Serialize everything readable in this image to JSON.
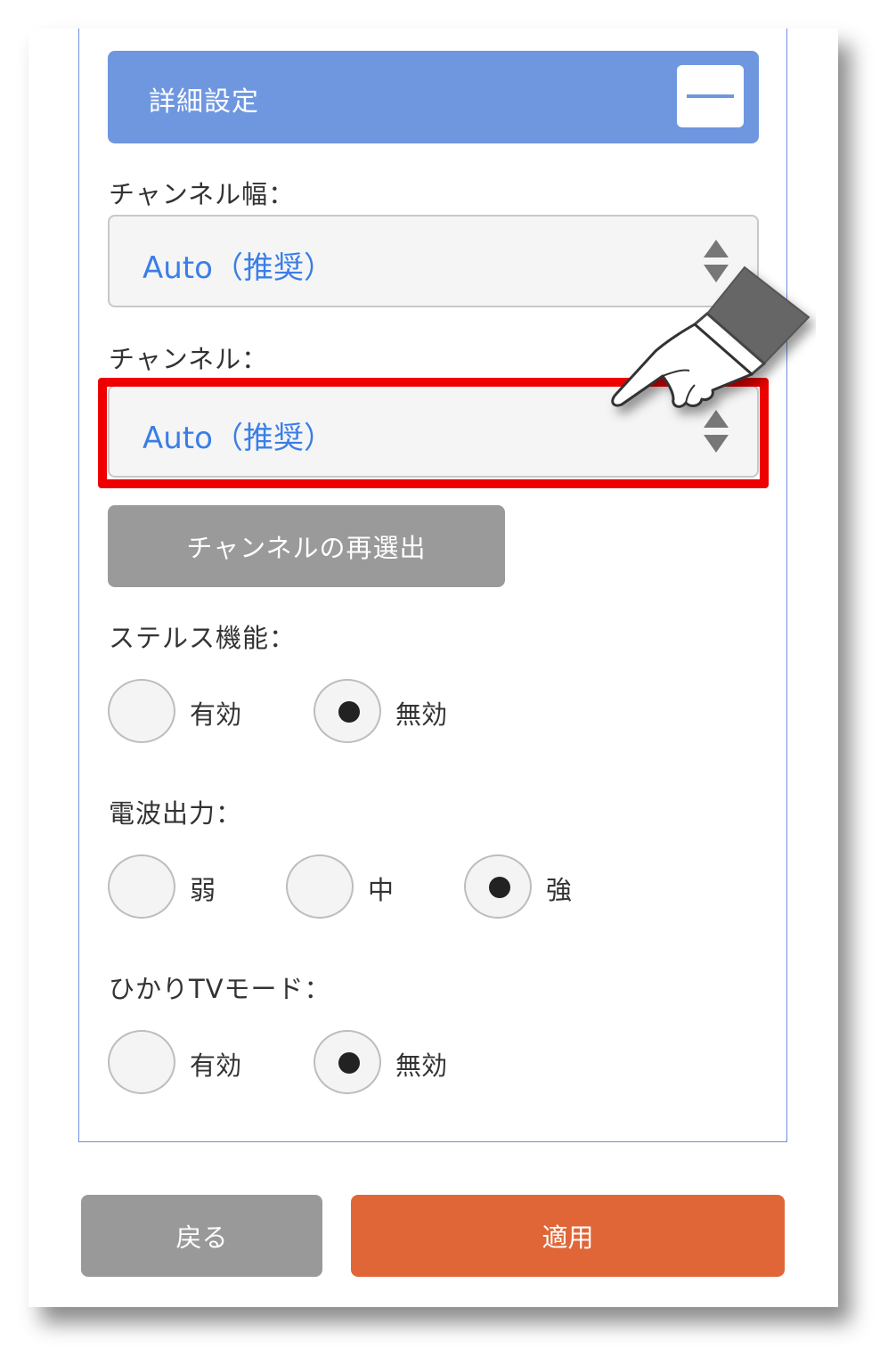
{
  "advanced": {
    "title": "詳細設定",
    "collapse_icon": "minus-icon"
  },
  "channel_width": {
    "label": "チャンネル幅：",
    "value": "Auto（推奨）"
  },
  "channel": {
    "label": "チャンネル：",
    "value": "Auto（推奨）"
  },
  "reselect_button": "チャンネルの再選出",
  "stealth": {
    "label": "ステルス機能：",
    "options": [
      "有効",
      "無効"
    ],
    "selected": "無効"
  },
  "radio_power": {
    "label": "電波出力：",
    "options": [
      "弱",
      "中",
      "強"
    ],
    "selected": "強"
  },
  "hikari_tv": {
    "label": "ひかりTVモード：",
    "options": [
      "有効",
      "無効"
    ],
    "selected": "無効"
  },
  "footer": {
    "back_label": "戻る",
    "apply_label": "適用"
  },
  "colors": {
    "header": "#6f97e0",
    "value_text": "#3b7ee6",
    "highlight": "#ee0000",
    "apply": "#e06638",
    "gray_button": "#9a9a9a"
  },
  "annotation_icon": "pointing-hand-icon"
}
